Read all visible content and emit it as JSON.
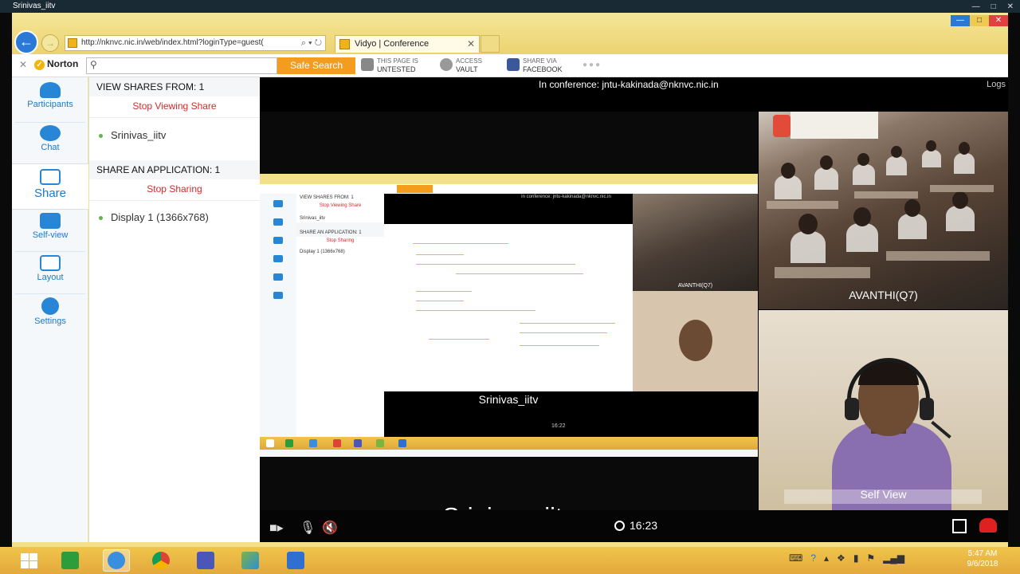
{
  "window": {
    "title": "Srinivas_iitv"
  },
  "browser": {
    "address": "http://nknvc.nic.in/web/index.html?loginType=guest(",
    "tab_title": "Vidyo | Conference",
    "tab_close": "✕"
  },
  "norton": {
    "brand": "Norton",
    "safe_search": "Safe Search",
    "page_status_line1": "THIS PAGE IS",
    "page_status_line2": "UNTESTED",
    "vault_line1": "ACCESS",
    "vault_line2": "VAULT",
    "facebook_line1": "SHARE VIA",
    "facebook_line2": "FACEBOOK"
  },
  "sidebar": {
    "items": [
      {
        "label": "Participants",
        "icon": "participants-icon"
      },
      {
        "label": "Chat",
        "icon": "chat-icon"
      },
      {
        "label": "Share",
        "icon": "share-icon"
      },
      {
        "label": "Self-view",
        "icon": "self-view-icon"
      },
      {
        "label": "Layout",
        "icon": "layout-icon"
      },
      {
        "label": "Settings",
        "icon": "gear-icon"
      }
    ],
    "active": "Share"
  },
  "panel": {
    "view_shares_header": "VIEW SHARES FROM: 1",
    "stop_viewing": "Stop Viewing Share",
    "share_source": "Srinivas_iitv",
    "share_app_header": "SHARE AN APPLICATION: 1",
    "stop_sharing": "Stop Sharing",
    "display_option": "Display 1 (1366x768)"
  },
  "conference": {
    "status": "In conference: jntu-kakinada@nknvc.nic.in",
    "logs_link": "Logs",
    "share_label": "Srinivas_iitv",
    "timer": "16:23",
    "tiles": [
      {
        "label": "AVANTHI(Q7)"
      },
      {
        "label": "Self View"
      }
    ]
  },
  "nested_share": {
    "panel_header": "VIEW SHARES FROM: 1",
    "stop_viewing": "Stop Viewing Share",
    "source": "Srinivas_iitv",
    "app_header": "SHARE AN APPLICATION: 1",
    "stop_sharing": "Stop Sharing",
    "display": "Display 1 (1366x768)",
    "status": "In conference: jntu-kakinada@nknvc.nic.in",
    "share_label": "Srinivas_iitv",
    "class_label": "AVANTHI(Q7)",
    "timer": "16:22"
  },
  "taskbar": {
    "time": "5:47 AM",
    "date": "9/6/2018"
  },
  "colors": {
    "accent_blue": "#1f78c8",
    "stop_red": "#d62a2a",
    "taskbar": "#e8b444"
  }
}
